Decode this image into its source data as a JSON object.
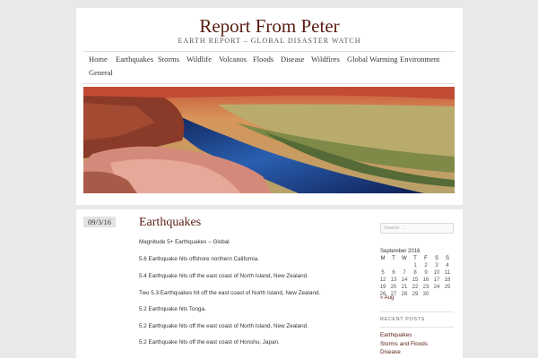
{
  "site": {
    "title": "Report From Peter",
    "tagline": "EARTH REPORT – GLOBAL DISASTER WATCH"
  },
  "nav": {
    "items": [
      "Home",
      "Earthquakes",
      "Storms",
      "Wildlife",
      "Volcanos",
      "Floods",
      "Disease",
      "Wildfires",
      "Global Warming",
      "Environment",
      "General"
    ]
  },
  "post": {
    "date": "09/3/16",
    "title": "Earthquakes",
    "lines": [
      "Magnitude 5+ Earthquakes – Global",
      "5.6 Earthquake hits offshore northern California.",
      "5.4 Earthquake hits off the east coast of North Island, New Zealand.",
      "Two 5.3 Earthquakes hit off the east coast of North Island, New Zealand.",
      "5.2 Earthquake hits Tonga.",
      "5.2 Earthquake hits off the east coast of North Island, New Zealand.",
      "5.2 Earthquake hits off the east coast of Honshu, Japan."
    ]
  },
  "sidebar": {
    "search_placeholder": "Search …",
    "calendar": {
      "caption": "September 2016",
      "days": [
        "M",
        "T",
        "W",
        "T",
        "F",
        "S",
        "S"
      ],
      "weeks": [
        [
          "",
          "",
          "",
          "1",
          "2",
          "3",
          "4"
        ],
        [
          "5",
          "6",
          "7",
          "8",
          "9",
          "10",
          "11"
        ],
        [
          "12",
          "13",
          "14",
          "15",
          "16",
          "17",
          "18"
        ],
        [
          "19",
          "20",
          "21",
          "22",
          "23",
          "24",
          "25"
        ],
        [
          "26",
          "27",
          "28",
          "29",
          "30",
          "",
          ""
        ]
      ],
      "prev_link": "« Aug"
    },
    "recent_posts": {
      "title": "RECENT POSTS",
      "items": [
        "Earthquakes",
        "Storms and Floods",
        "Disease"
      ]
    }
  },
  "colors": {
    "accent": "#5a1e14",
    "background": "#e9e9e9"
  }
}
